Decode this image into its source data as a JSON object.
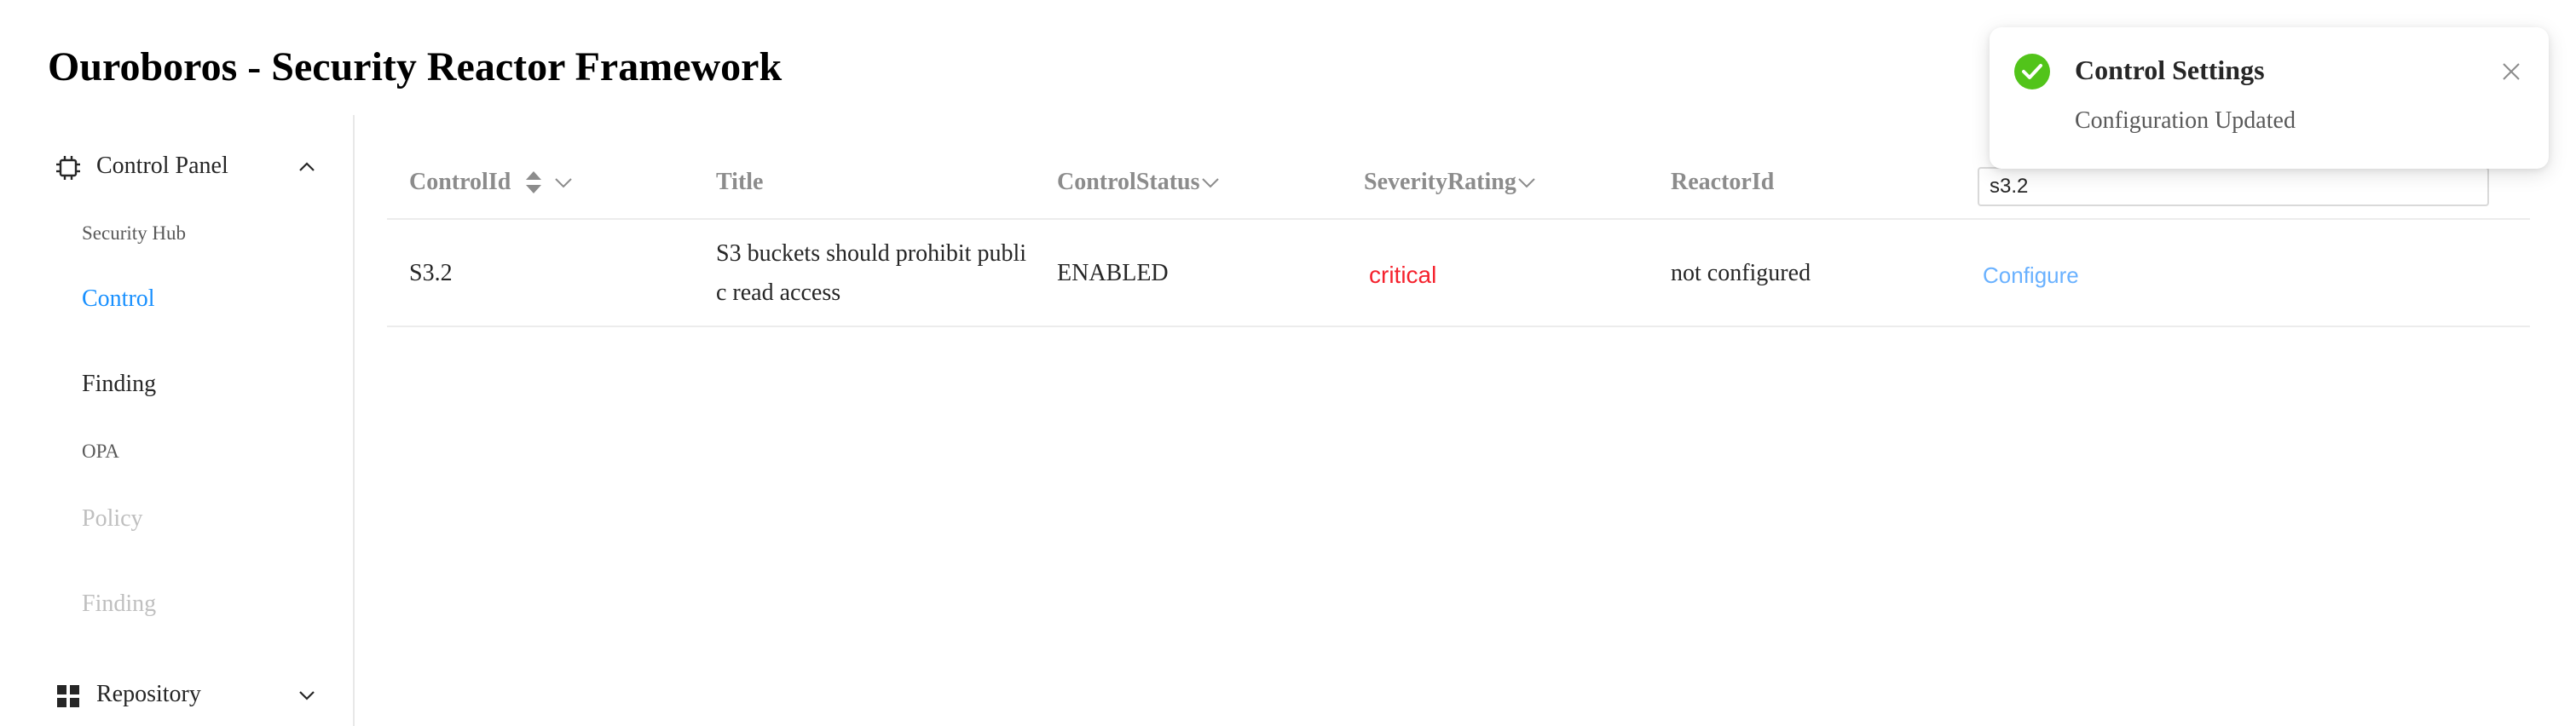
{
  "app": {
    "title": "Ouroboros - Security Reactor Framework"
  },
  "sidebar": {
    "control_panel": {
      "label": "Control Panel",
      "icon": "chip-icon",
      "expanded": true
    },
    "items": [
      {
        "label": "Security Hub",
        "state": "normal"
      },
      {
        "label": "Control",
        "state": "active"
      },
      {
        "label": "Finding",
        "state": "normal"
      },
      {
        "label": "OPA",
        "state": "normal"
      },
      {
        "label": "Policy",
        "state": "disabled"
      },
      {
        "label": "Finding",
        "state": "disabled"
      }
    ],
    "repository": {
      "label": "Repository",
      "icon": "grid-icon",
      "expanded": false
    }
  },
  "table": {
    "columns": [
      {
        "label": "ControlId",
        "sortable": true,
        "filterable": true
      },
      {
        "label": "Title"
      },
      {
        "label": "ControlStatus",
        "filterable": true
      },
      {
        "label": "SeverityRating",
        "filterable": true
      },
      {
        "label": "ReactorId"
      }
    ],
    "rows": [
      {
        "control_id": "S3.2",
        "title": "S3 buckets should prohibit public read access",
        "status": "ENABLED",
        "severity": "critical",
        "reactor_id": "not configured",
        "action": "Configure"
      }
    ]
  },
  "search": {
    "value": "s3.2"
  },
  "toast": {
    "title": "Control Settings",
    "message": "Configuration Updated",
    "icon": "check-circle-icon"
  },
  "colors": {
    "accent": "#1890ff",
    "critical": "#f5222d",
    "success": "#52c41a",
    "link": "#69b1ff"
  }
}
